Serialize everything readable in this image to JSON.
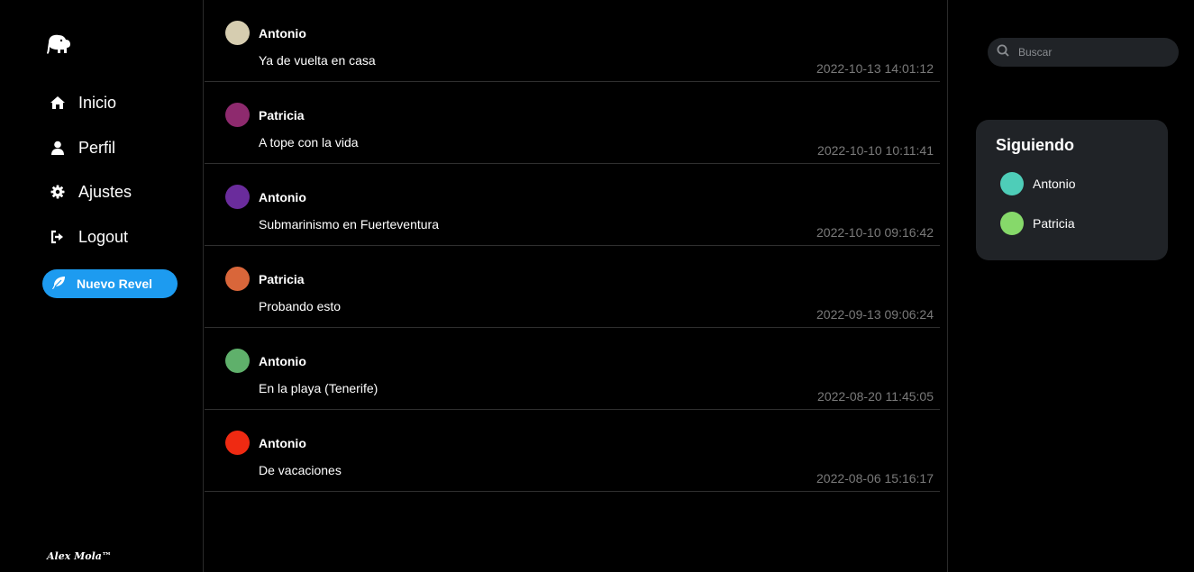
{
  "sidebar": {
    "logo_icon": "elephant-icon",
    "nav": [
      {
        "label": "Inicio",
        "icon": "home-icon"
      },
      {
        "label": "Perfil",
        "icon": "user-icon"
      },
      {
        "label": "Ajustes",
        "icon": "gear-icon"
      },
      {
        "label": "Logout",
        "icon": "logout-icon"
      }
    ],
    "new_button": {
      "label": "Nuevo Revel",
      "icon": "feather-icon",
      "color": "#1d9bf0"
    },
    "footer": "Alex Mola™"
  },
  "feed": {
    "posts": [
      {
        "author": "Antonio",
        "text": "Ya de vuelta en casa",
        "time": "2022-10-13 14:01:12",
        "avatar_color": "#d6cdb0"
      },
      {
        "author": "Patricia",
        "text": "A tope con la vida",
        "time": "2022-10-10 10:11:41",
        "avatar_color": "#8e2a6e"
      },
      {
        "author": "Antonio",
        "text": "Submarinismo en Fuerteventura",
        "time": "2022-10-10 09:16:42",
        "avatar_color": "#6a2c9c"
      },
      {
        "author": "Patricia",
        "text": "Probando esto",
        "time": "2022-09-13 09:06:24",
        "avatar_color": "#d9663a"
      },
      {
        "author": "Antonio",
        "text": "En la playa (Tenerife)",
        "time": "2022-08-20 11:45:05",
        "avatar_color": "#5fb06b"
      },
      {
        "author": "Antonio",
        "text": "De vacaciones",
        "time": "2022-08-06 15:16:17",
        "avatar_color": "#ef2a12"
      }
    ]
  },
  "search": {
    "placeholder": "Buscar",
    "icon": "search-icon"
  },
  "following": {
    "title": "Siguiendo",
    "users": [
      {
        "name": "Antonio",
        "avatar_color": "#4ecdb8"
      },
      {
        "name": "Patricia",
        "avatar_color": "#86d96a"
      }
    ]
  }
}
